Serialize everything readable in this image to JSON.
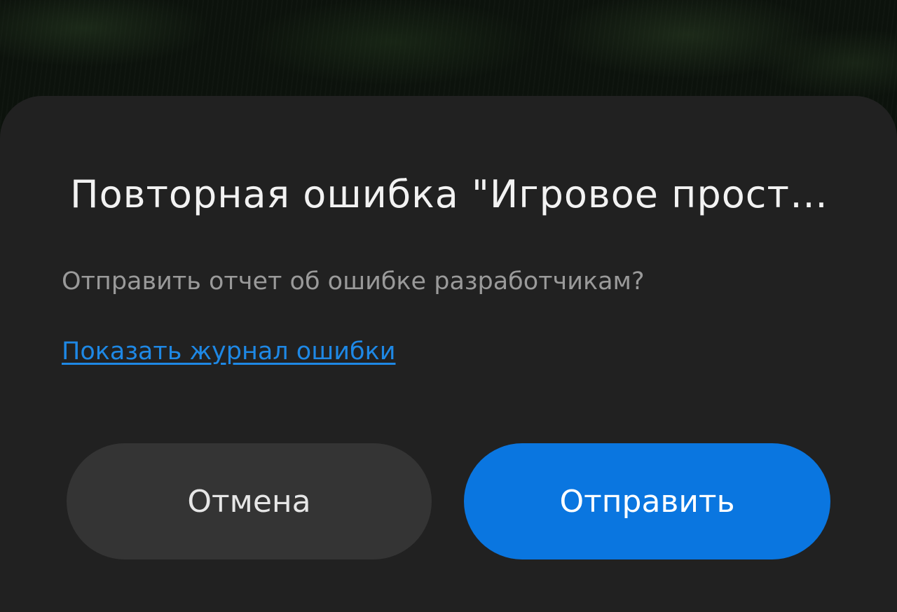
{
  "dialog": {
    "title": "Повторная ошибка \"Игровое пространство\"",
    "message": "Отправить отчет об ошибке разработчикам?",
    "log_link": "Показать журнал ошибки",
    "cancel_label": "Отмена",
    "send_label": "Отправить"
  },
  "colors": {
    "dialog_bg": "#212121",
    "accent": "#0a76e0",
    "link": "#1e88e5",
    "cancel_bg": "#343434"
  }
}
